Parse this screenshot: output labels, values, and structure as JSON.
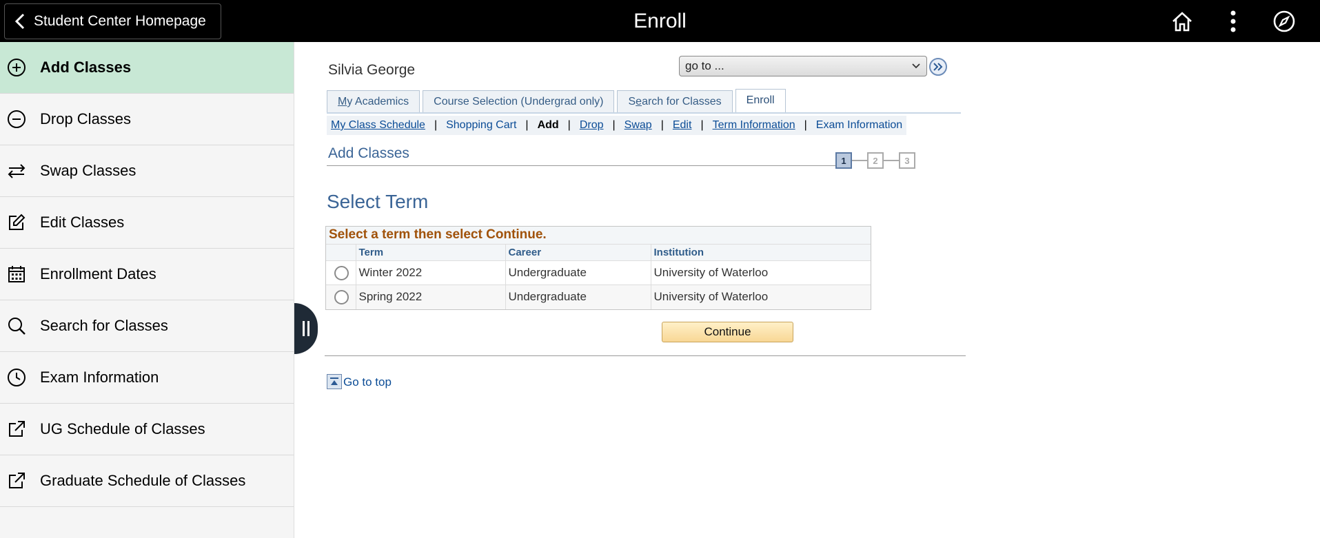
{
  "header": {
    "back_label": "Student Center Homepage",
    "title": "Enroll",
    "icons": [
      "home-icon",
      "more-vertical-icon",
      "compass-icon"
    ]
  },
  "sidebar": {
    "items": [
      {
        "label": "Add Classes",
        "icon": "plus-circle-icon",
        "active": true
      },
      {
        "label": "Drop Classes",
        "icon": "minus-circle-icon"
      },
      {
        "label": "Swap Classes",
        "icon": "swap-arrows-icon"
      },
      {
        "label": "Edit Classes",
        "icon": "edit-icon"
      },
      {
        "label": "Enrollment Dates",
        "icon": "calendar-icon"
      },
      {
        "label": "Search for Classes",
        "icon": "search-icon"
      },
      {
        "label": "Exam Information",
        "icon": "clock-icon"
      },
      {
        "label": "UG Schedule of Classes",
        "icon": "external-link-icon"
      },
      {
        "label": "Graduate Schedule of Classes",
        "icon": "external-link-icon"
      }
    ]
  },
  "main": {
    "student_name": "Silvia George",
    "goto_value": "go to ...",
    "tabs": [
      {
        "first": "M",
        "rest": "y Academics"
      },
      {
        "first": "",
        "rest": "Course Selection (Undergrad only)"
      },
      {
        "pre": "S",
        "u": "e",
        "post": "arch for Classes"
      },
      {
        "label": "Enroll",
        "active": true
      }
    ],
    "subnav": {
      "my_class_schedule": "My Class Schedule",
      "shopping_cart": "Shopping Cart",
      "add": "Add",
      "drop": "Drop",
      "swap": "Swap",
      "edit": "Edit",
      "term_information": "Term Information",
      "exam_information": "Exam Information",
      "separator": "|"
    },
    "section_title": "Add Classes",
    "steps": [
      "1",
      "2",
      "3"
    ],
    "select_term_title": "Select Term",
    "grid": {
      "caption": "Select a term then select Continue.",
      "columns": [
        "Term",
        "Career",
        "Institution"
      ],
      "rows": [
        {
          "term": "Winter 2022",
          "career": "Undergraduate",
          "institution": "University of Waterloo"
        },
        {
          "term": "Spring 2022",
          "career": "Undergraduate",
          "institution": "University of Waterloo"
        }
      ]
    },
    "continue_label": "Continue",
    "goto_top_label": "Go to top"
  }
}
